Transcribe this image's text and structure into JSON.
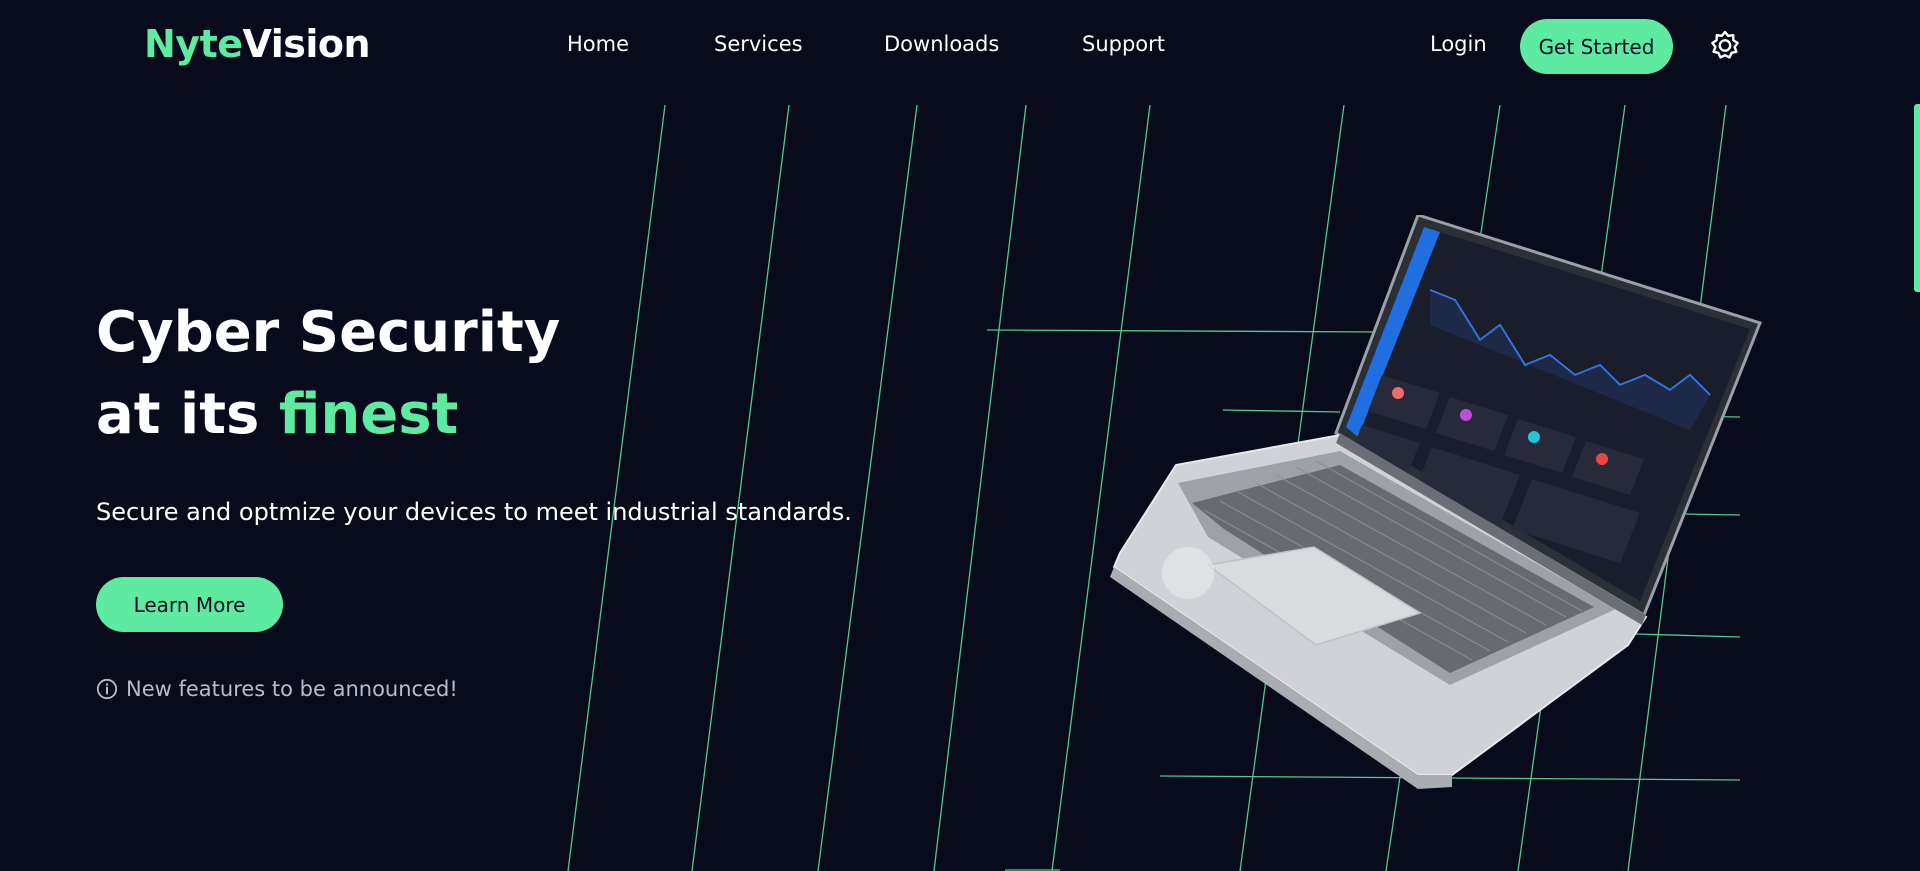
{
  "brand": {
    "logo_accent": "Nyte",
    "logo_rest": "Vision",
    "accent_color": "#5eeaa0",
    "background_color": "#070b1c"
  },
  "nav": {
    "items": [
      {
        "label": "Home"
      },
      {
        "label": "Services"
      },
      {
        "label": "Downloads"
      },
      {
        "label": "Support"
      }
    ],
    "login_label": "Login",
    "cta_label": "Get Started",
    "theme_icon": "sun-gear-icon"
  },
  "hero": {
    "title_line1": "Cyber Security",
    "title_line2_prefix": "at its",
    "title_line2_highlight": "finest",
    "subtitle": "Secure and optmize your devices to meet industrial standards.",
    "button_label": "Learn More",
    "notice_icon": "info-icon",
    "notice": "New features to be announced!"
  },
  "illustration": {
    "subject": "laptop-dashboard-icon"
  }
}
